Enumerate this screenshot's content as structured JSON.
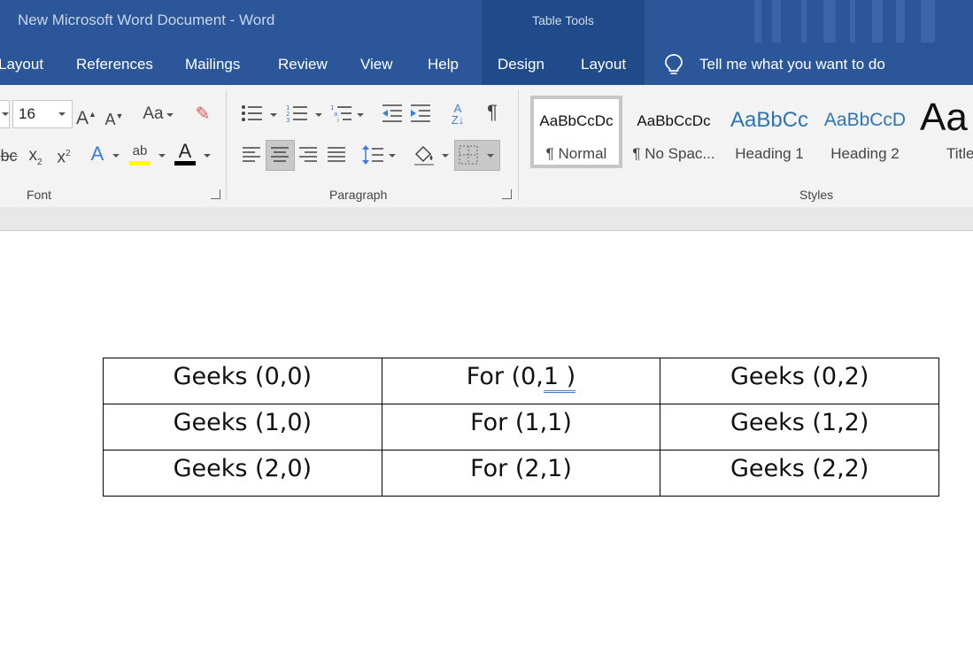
{
  "window": {
    "title": "New Microsoft Word Document  -  Word",
    "contextual_tab_group": "Table Tools"
  },
  "tabs": [
    {
      "label": "Layout"
    },
    {
      "label": "References"
    },
    {
      "label": "Mailings"
    },
    {
      "label": "Review"
    },
    {
      "label": "View"
    },
    {
      "label": "Help"
    },
    {
      "label": "Design"
    },
    {
      "label": "Layout"
    }
  ],
  "tell_me": "Tell me what you want to do",
  "ribbon": {
    "font": {
      "label": "Font",
      "size": "16",
      "icons": [
        "grow-font-icon",
        "shrink-font-icon",
        "change-case-icon",
        "clear-formatting-icon",
        "strikethrough-icon",
        "subscript-icon",
        "superscript-icon",
        "text-effects-icon",
        "highlight-icon",
        "font-color-icon"
      ],
      "highlight_color": "#ffff00",
      "font_color": "#000000"
    },
    "paragraph": {
      "label": "Paragraph",
      "icons": [
        "bullets-icon",
        "numbering-icon",
        "multilevel-list-icon",
        "decrease-indent-icon",
        "increase-indent-icon",
        "sort-icon",
        "show-formatting-icon",
        "align-left-icon",
        "align-center-icon",
        "align-right-icon",
        "justify-icon",
        "line-spacing-icon",
        "shading-icon",
        "borders-icon"
      ]
    },
    "styles": {
      "label": "Styles",
      "items": [
        {
          "sample": "AaBbCcDc",
          "name": "¶ Normal"
        },
        {
          "sample": "AaBbCcDc",
          "name": "¶ No Spac..."
        },
        {
          "sample": "AaBbCc",
          "name": "Heading 1"
        },
        {
          "sample": "AaBbCcD",
          "name": "Heading 2"
        },
        {
          "sample": "Aa",
          "name": "Title"
        }
      ]
    }
  },
  "table": {
    "rows": [
      [
        "Geeks (0,0)",
        "For (0,",
        "Geeks (0,2)"
      ],
      [
        "Geeks (1,0)",
        "For (1,1)",
        "Geeks (1,2)"
      ],
      [
        "Geeks (2,0)",
        "For (2,1)",
        "Geeks (2,2)"
      ]
    ],
    "cell_0_1_underlined": "1 )"
  },
  "colors": {
    "ribbon_blue": "#2b579a",
    "contextual_blue": "#204b8a",
    "heading_blue": "#2e74b5"
  }
}
